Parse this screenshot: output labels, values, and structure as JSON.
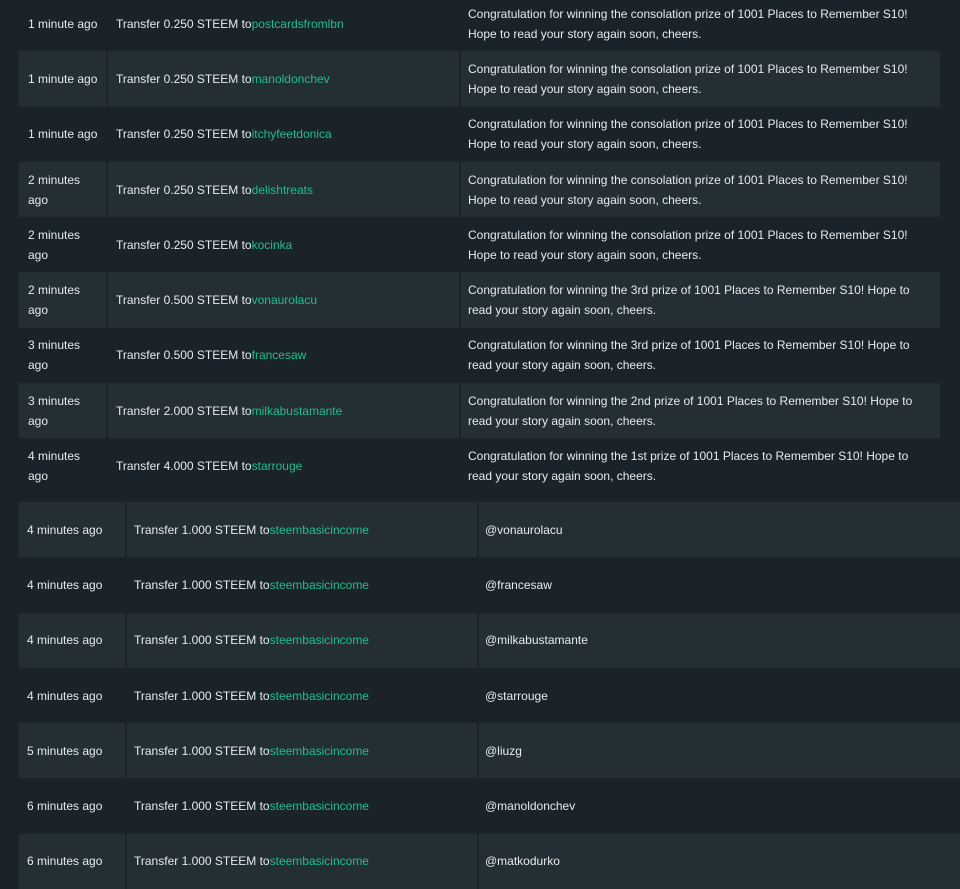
{
  "colors": {
    "background": "#1b232a",
    "row_alt": "#232e35",
    "link": "#1fbf8f",
    "text": "#e6ebee"
  },
  "rows": [
    {
      "time": "1 minute ago",
      "op_prefix": "Transfer 0.250 STEEM to ",
      "to": "postcardsfromlbn",
      "memo": "Congratulation for winning the consolation prize of 1001 Places to Remember S10! Hope to read your story again soon, cheers."
    },
    {
      "time": "1 minute ago",
      "op_prefix": "Transfer 0.250 STEEM to ",
      "to": "manoldonchev",
      "memo": "Congratulation for winning the consolation prize of 1001 Places to Remember S10! Hope to read your story again soon, cheers."
    },
    {
      "time": "1 minute ago",
      "op_prefix": "Transfer 0.250 STEEM to ",
      "to": "itchyfeetdonica",
      "memo": "Congratulation for winning the consolation prize of 1001 Places to Remember S10! Hope to read your story again soon, cheers."
    },
    {
      "time": "2 minutes ago",
      "op_prefix": "Transfer 0.250 STEEM to ",
      "to": "delishtreats",
      "memo": "Congratulation for winning the consolation prize of 1001 Places to Remember S10! Hope to read your story again soon, cheers."
    },
    {
      "time": "2 minutes ago",
      "op_prefix": "Transfer 0.250 STEEM to ",
      "to": "kocinka",
      "memo": "Congratulation for winning the consolation prize of 1001 Places to Remember S10! Hope to read your story again soon, cheers."
    },
    {
      "time": "2 minutes ago",
      "op_prefix": "Transfer 0.500 STEEM to ",
      "to": "vonaurolacu",
      "memo": "Congratulation for winning the 3rd prize of 1001 Places to Remember S10! Hope to read your story again soon, cheers."
    },
    {
      "time": "3 minutes ago",
      "op_prefix": "Transfer 0.500 STEEM to ",
      "to": "francesaw",
      "memo": "Congratulation for winning the 3rd prize of 1001 Places to Remember S10! Hope to read your story again soon, cheers."
    },
    {
      "time": "3 minutes ago",
      "op_prefix": "Transfer 2.000 STEEM to ",
      "to": "milkabustamante",
      "memo": "Congratulation for winning the 2nd prize of 1001 Places to Remember S10! Hope to read your story again soon, cheers."
    },
    {
      "time": "4 minutes ago",
      "op_prefix": "Transfer 4.000 STEEM to ",
      "to": "starrouge",
      "memo": "Congratulation for winning the 1st prize of 1001 Places to Remember S10! Hope to read your story again soon, cheers."
    },
    {
      "time": "4 minutes ago",
      "op_prefix": "Transfer 1.000 STEEM to ",
      "to": "steembasicincome",
      "memo": "@vonaurolacu"
    },
    {
      "time": "4 minutes ago",
      "op_prefix": "Transfer 1.000 STEEM to ",
      "to": "steembasicincome",
      "memo": "@francesaw"
    },
    {
      "time": "4 minutes ago",
      "op_prefix": "Transfer 1.000 STEEM to ",
      "to": "steembasicincome",
      "memo": "@milkabustamante"
    },
    {
      "time": "4 minutes ago",
      "op_prefix": "Transfer 1.000 STEEM to ",
      "to": "steembasicincome",
      "memo": "@starrouge"
    },
    {
      "time": "5 minutes ago",
      "op_prefix": "Transfer 1.000 STEEM to ",
      "to": "steembasicincome",
      "memo": "@liuzg"
    },
    {
      "time": "6 minutes ago",
      "op_prefix": "Transfer 1.000 STEEM to ",
      "to": "steembasicincome",
      "memo": "@manoldonchev"
    },
    {
      "time": "6 minutes ago",
      "op_prefix": "Transfer 1.000 STEEM to ",
      "to": "steembasicincome",
      "memo": "@matkodurko"
    }
  ]
}
